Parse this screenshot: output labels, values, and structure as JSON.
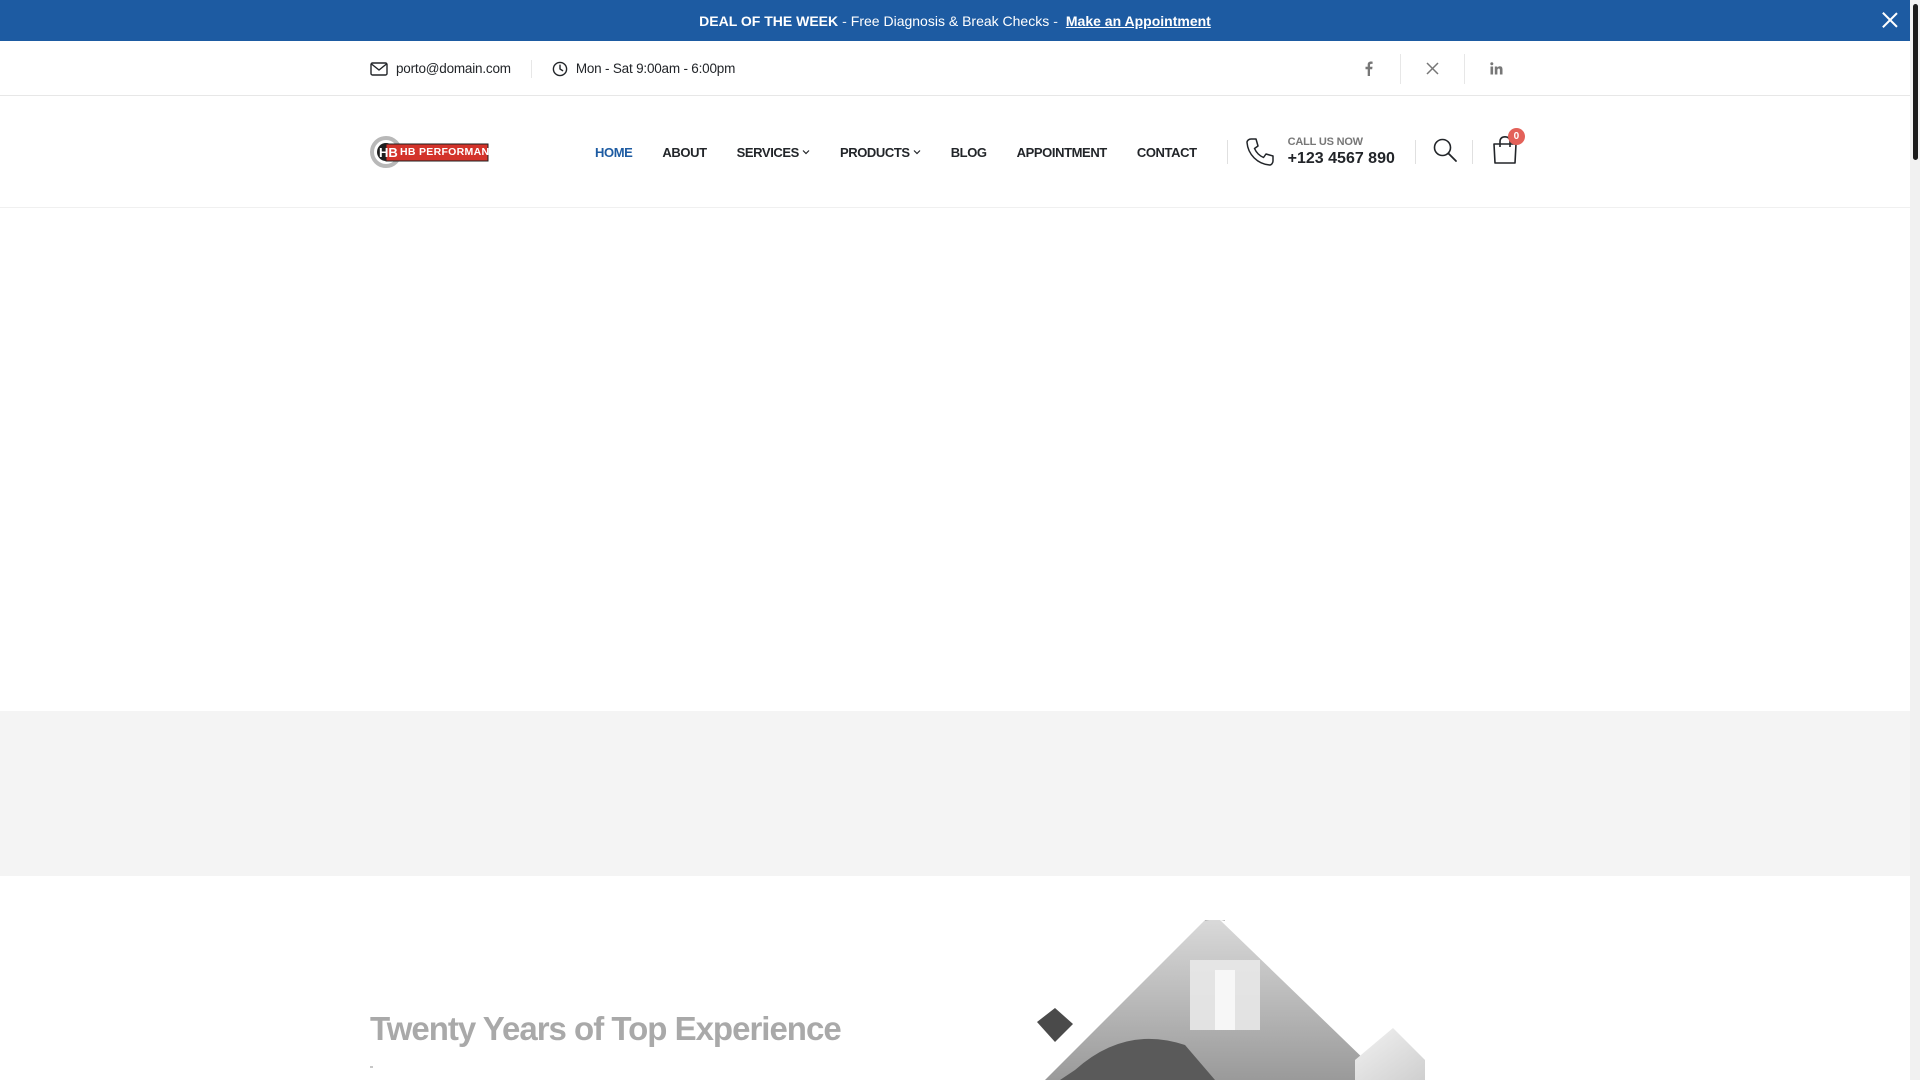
{
  "promo": {
    "strong": "DEAL OF THE WEEK",
    "sep1": "-",
    "text": "Free Diagnosis & Break Checks",
    "sep2": "-",
    "link": "Make an Appointment"
  },
  "topbar": {
    "email": "porto@domain.com",
    "hours": "Mon - Sat 9:00am - 6:00pm",
    "social": [
      "facebook-icon",
      "x-twitter-icon",
      "linkedin-icon"
    ]
  },
  "header": {
    "logo_text": "HB PERFORMANCE",
    "nav": [
      {
        "label": "HOME",
        "active": true
      },
      {
        "label": "ABOUT"
      },
      {
        "label": "SERVICES",
        "dropdown": true
      },
      {
        "label": "PRODUCTS",
        "dropdown": true
      },
      {
        "label": "BLOG"
      },
      {
        "label": "APPOINTMENT"
      },
      {
        "label": "CONTACT"
      }
    ],
    "phone_label": "CALL US NOW",
    "phone_number": "+123 4567 890",
    "cart_count": "0"
  },
  "about": {
    "title": "Twenty Years of Top Experience"
  },
  "colors": {
    "brand_blue": "#1d5ba2",
    "badge_red": "#e36159",
    "text_dark": "#222529"
  }
}
